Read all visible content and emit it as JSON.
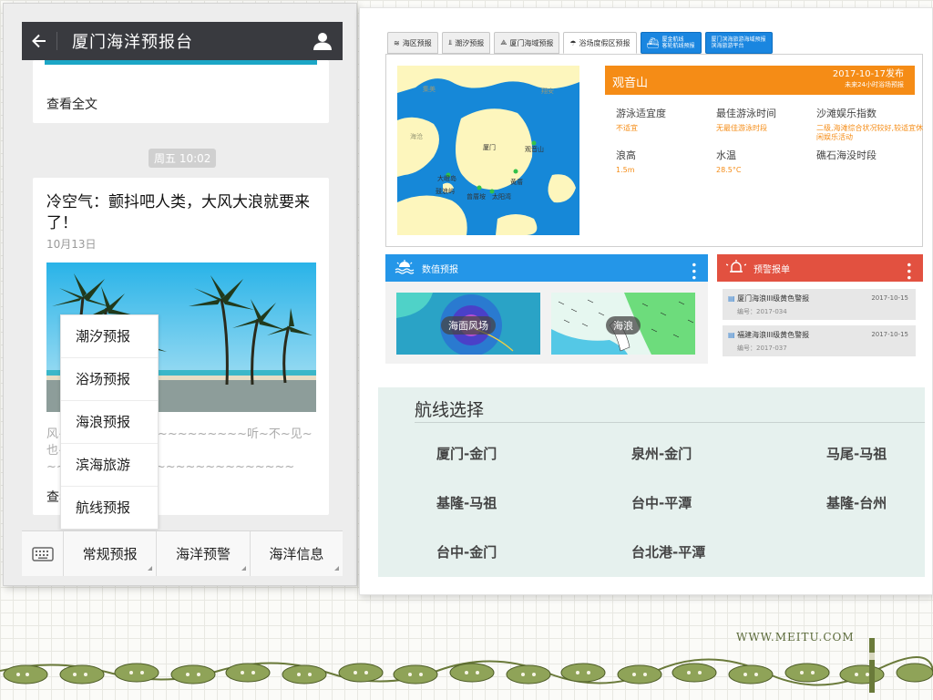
{
  "wechat": {
    "title": "厦门海洋预报台",
    "top_card_more": "查看全文",
    "time_chip": "周五 10:02",
    "article": {
      "title": "冷空气：颤抖吧人类，大风大浪就要来了！",
      "date": "10月13日",
      "excerpt": "风~~~~~~~~~~~~~~~~~~~听~不~见~也~看~不~清~~~~~~~~~~~~~~~~~~~~~~~~~",
      "more": "查看"
    },
    "popup_menu": [
      "潮汐预报",
      "浴场预报",
      "海浪预报",
      "滨海旅游",
      "航线预报"
    ],
    "bottom_menu": [
      "常规预报",
      "海洋预警",
      "海洋信息"
    ]
  },
  "site": {
    "tabs": [
      "海区预报",
      "潮汐预报",
      "厦门海域预报",
      "浴场度假区预报"
    ],
    "blue_tabs": [
      {
        "l1": "厦金航线",
        "l2": "客轮航线预报"
      },
      {
        "l1": "厦门滨海旅游海域预报",
        "l2": "滨海旅游平台"
      }
    ],
    "map_labels": [
      "观音山",
      "大嶝岛",
      "厦门",
      "海沧",
      "集美",
      "翔安",
      "鼓浪屿",
      "曾厝垵",
      "太阳湾",
      "黄厝"
    ],
    "beach": {
      "name": "观音山",
      "date": "2017-10-17发布",
      "date_sub": "未来24小时浴场预报",
      "fields": [
        {
          "label": "游泳适宜度",
          "value": "不适宜"
        },
        {
          "label": "最佳游泳时间",
          "value": "无最佳游泳时段"
        },
        {
          "label": "沙滩娱乐指数",
          "value": "二级,海滩综合状况较好,较适宜休闲娱乐活动"
        },
        {
          "label": "浪高",
          "value": "1.5m"
        },
        {
          "label": "水温",
          "value": "28.5°C"
        },
        {
          "label": "礁石海没时段",
          "value": ""
        }
      ]
    },
    "numeric_panel": {
      "title": "数值预报",
      "thumbs": [
        "海面风场",
        "海浪"
      ]
    },
    "warning_panel": {
      "title": "预警报单",
      "items": [
        {
          "title": "厦门海浪III级黄色警报",
          "no": "编号：2017-034",
          "date": "2017-10-15"
        },
        {
          "title": "福建海浪III级黄色警报",
          "no": "编号：2017-037",
          "date": "2017-10-15"
        }
      ]
    },
    "routes": {
      "title": "航线选择",
      "items": [
        "厦门-金门",
        "泉州-金门",
        "马尾-马祖",
        "基隆-马祖",
        "台中-平潭",
        "基隆-台州",
        "台中-金门",
        "台北港-平潭"
      ]
    }
  },
  "watermark": "WWW.MEITU.COM",
  "colors": {
    "wechat_header": "#393a3f",
    "orange": "#f58c16",
    "blue": "#2496e8",
    "red": "#e25140"
  }
}
